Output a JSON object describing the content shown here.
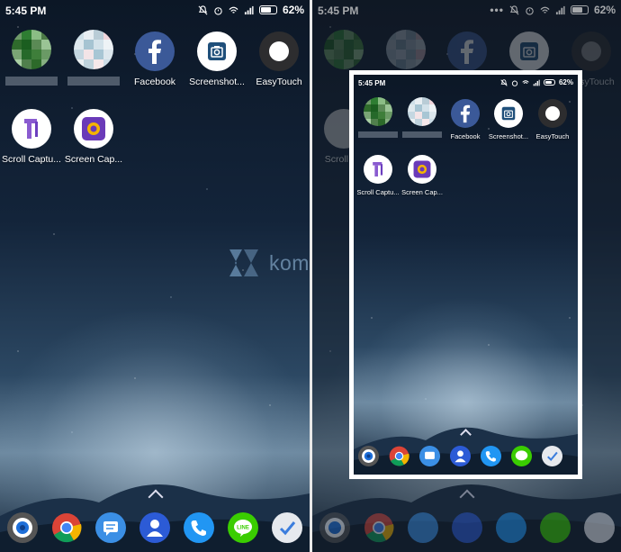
{
  "left": {
    "status": {
      "time": "5:45 PM",
      "battery": "62%"
    },
    "apps": [
      {
        "label": "",
        "icon": "blurred-app-icon"
      },
      {
        "label": "",
        "icon": "blurred-app-icon"
      },
      {
        "label": "Facebook",
        "icon": "facebook-icon"
      },
      {
        "label": "Screenshot...",
        "icon": "camera-icon"
      },
      {
        "label": "EasyTouch",
        "icon": "easytouch-icon"
      },
      {
        "label": "Scroll Captu...",
        "icon": "scroll-capture-icon"
      },
      {
        "label": "Screen Cap...",
        "icon": "screen-capture-icon"
      }
    ],
    "watermark": "kompiwin",
    "dock": [
      "chrome-camera",
      "chrome",
      "messages",
      "contacts",
      "phone",
      "line",
      "tasks"
    ]
  },
  "right": {
    "status": {
      "time": "5:45 PM",
      "battery": "62%"
    },
    "background_labels": {
      "easytouch": "EasyTouch",
      "scroll": "Scroll Ca"
    },
    "preview": {
      "status": {
        "time": "5:45 PM",
        "battery": "62%"
      },
      "apps": [
        {
          "label": "",
          "icon": "blurred-app-icon"
        },
        {
          "label": "",
          "icon": "blurred-app-icon"
        },
        {
          "label": "Facebook",
          "icon": "facebook-icon"
        },
        {
          "label": "Screenshot...",
          "icon": "camera-icon"
        },
        {
          "label": "EasyTouch",
          "icon": "easytouch-icon"
        },
        {
          "label": "Scroll Captu...",
          "icon": "scroll-capture-icon"
        },
        {
          "label": "Screen Cap...",
          "icon": "screen-capture-icon"
        }
      ]
    }
  },
  "colors": {
    "facebook": "#3b5998",
    "screen_capture": "#6a3ab8",
    "phone": "#2196f3",
    "line": "#3acd01",
    "contacts": "#2c5bd6",
    "messages": "#3b8fe5"
  }
}
